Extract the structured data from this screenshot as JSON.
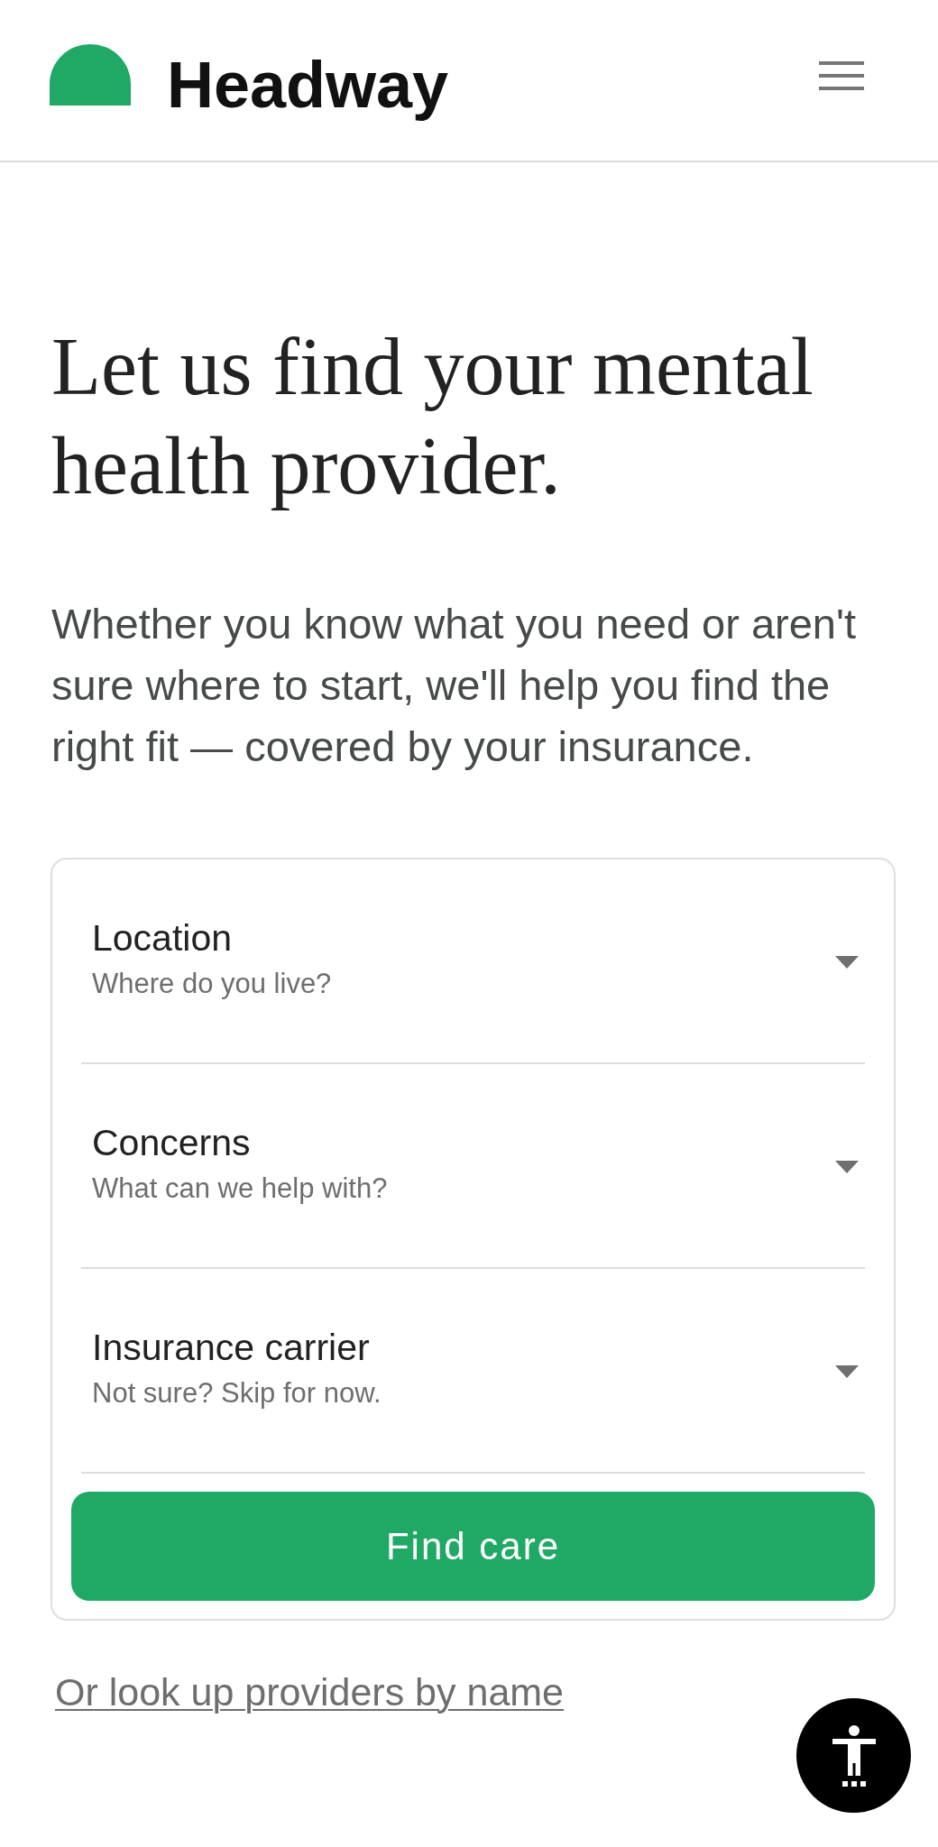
{
  "header": {
    "brand": "Headway"
  },
  "hero": {
    "title": "Let us find your mental health provider.",
    "intro": "Whether you know what you need or aren't sure where to start, we'll help you find the right fit — covered by your insurance."
  },
  "search_form": {
    "fields": [
      {
        "label": "Location",
        "placeholder": "Where do you live?"
      },
      {
        "label": "Concerns",
        "placeholder": "What can we help with?"
      },
      {
        "label": "Insurance carrier",
        "placeholder": "Not sure? Skip for now."
      }
    ],
    "submit_button": "Find care"
  },
  "lookup_link": "Or look up providers by name"
}
